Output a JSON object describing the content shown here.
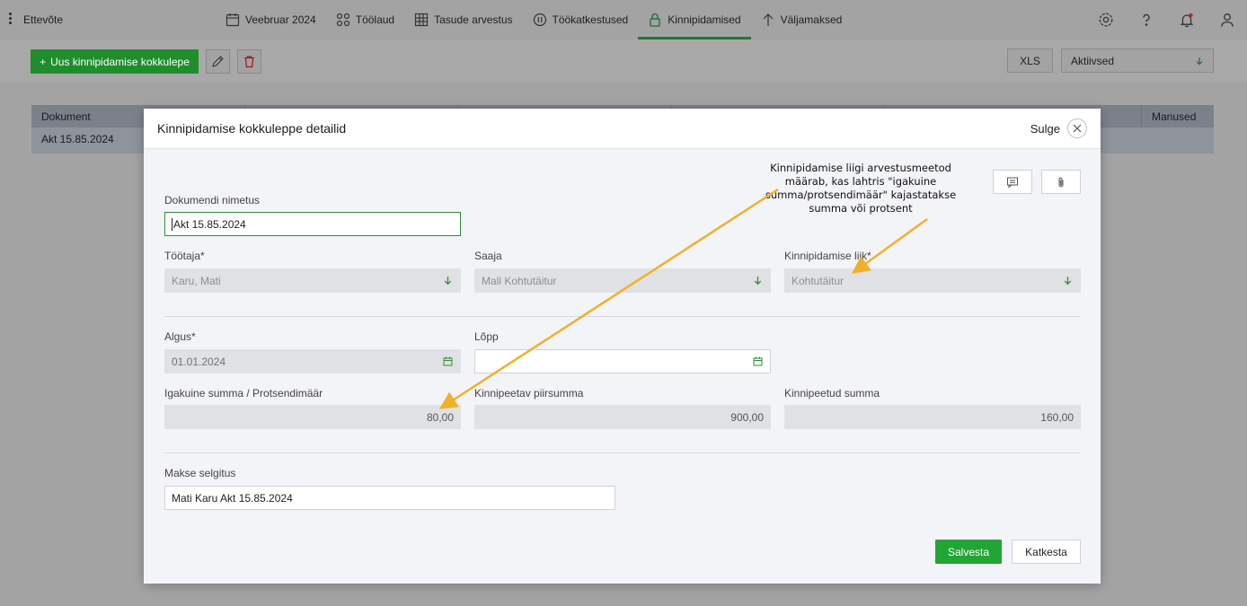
{
  "app": {
    "company": "Ettevõte",
    "nav": [
      {
        "label": "Veebruar 2024",
        "icon": "calendar-icon"
      },
      {
        "label": "Töölaud",
        "icon": "dashboard-icon"
      },
      {
        "label": "Tasude arvestus",
        "icon": "grid-calc-icon"
      },
      {
        "label": "Töökatkestused",
        "icon": "pause-circle-icon"
      },
      {
        "label": "Kinnipidamised",
        "icon": "lock-icon",
        "active": true
      },
      {
        "label": "Väljamaksed",
        "icon": "arrow-up-icon"
      }
    ],
    "top_icons": [
      "settings-icon",
      "help-icon",
      "notifications-icon",
      "user-icon"
    ]
  },
  "toolbar": {
    "new_label": "Uus kinnipidamise kokkulepe",
    "xls_label": "XLS",
    "status_filter": "Aktiivsed"
  },
  "grid": {
    "headers": [
      "Dokument",
      "Manused"
    ],
    "rows": [
      [
        "Akt 15.85.2024"
      ]
    ]
  },
  "modal": {
    "title": "Kinnipidamise kokkuleppe detailid",
    "close_label": "Sulge",
    "fields": {
      "doc_name": {
        "label": "Dokumendi nimetus",
        "value": "Akt 15.85.2024"
      },
      "employee": {
        "label": "Töötaja*",
        "value": "Karu, Mati"
      },
      "recipient": {
        "label": "Saaja",
        "value": "Mall Kohtutäitur"
      },
      "type": {
        "label": "Kinnipidamise liik*",
        "value": "Kohtutäitur"
      },
      "start": {
        "label": "Algus*",
        "value": "01.01.2024"
      },
      "end": {
        "label": "Lõpp",
        "value": ""
      },
      "monthly": {
        "label": "Igakuine summa / Protsendimäär",
        "value": "80,00"
      },
      "limit": {
        "label": "Kinnipeetav piirsumma",
        "value": "900,00"
      },
      "withheld": {
        "label": "Kinnipeetud summa",
        "value": "160,00"
      },
      "explanation": {
        "label": "Makse selgitus",
        "value": "Mati Karu Akt 15.85.2024"
      }
    },
    "save_label": "Salvesta",
    "cancel_label": "Katkesta"
  },
  "annotation": {
    "text": "Kinnipidamise liigi arvestusmeetod määrab, kas lahtris \"igakuine summa/protsendimäär\" kajastatakse summa või protsent",
    "arrow_color": "#f0b12a"
  }
}
